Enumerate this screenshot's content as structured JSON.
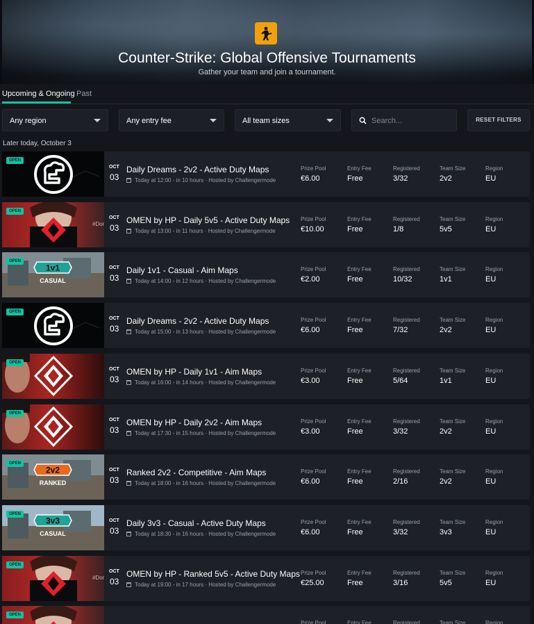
{
  "hero": {
    "title": "Counter-Strike: Global Offensive Tournaments",
    "subtitle": "Gather your team and join a tournament.",
    "game_icon": "csgo-soldier-icon",
    "accent": "#f0a10a"
  },
  "tabs": {
    "active": "Upcoming & Ongoing",
    "inactive": "Past"
  },
  "filters": {
    "region": "Any region",
    "entry_fee": "Any entry fee",
    "team_size": "All team sizes",
    "search_placeholder": "Search...",
    "reset_label": "RESET FILTERS"
  },
  "date_heading": "Later today, October 3",
  "colors": {
    "accent": "#12c2a0",
    "row_bg": "#1d2027",
    "page_bg": "#14161c"
  },
  "labels": {
    "prize": "Prize Pool",
    "fee": "Entry Fee",
    "registered": "Registered",
    "team_size": "Team Size",
    "region": "Region",
    "badge": "OPEN"
  },
  "tournaments": [
    {
      "thumb": "daily-dreams-logo",
      "month": "OCT",
      "day": "03",
      "title": "Daily Dreams - 2v2 - Active Duty Maps",
      "time": "Today at 12:00 - in 10 hours",
      "host": "Hosted by Challengermode",
      "prize": "€6.00",
      "fee": "Free",
      "registered": "3/32",
      "team_size": "2v2",
      "region": "EU"
    },
    {
      "thumb": "omen-5v5",
      "month": "OCT",
      "day": "03",
      "title": "OMEN by HP - Daily 5v5 - Active Duty Maps",
      "time": "Today at 13:00 - in 11 hours",
      "host": "Hosted by Challengermode",
      "prize": "€10.00",
      "fee": "Free",
      "registered": "1/8",
      "team_size": "5v5",
      "region": "EU"
    },
    {
      "thumb": "casual-1v1",
      "badge_text": "1v1",
      "badge_sub": "CASUAL",
      "month": "OCT",
      "day": "03",
      "title": "Daily 1v1 - Casual - Aim Maps",
      "time": "Today at 14:00 - in 12 hours",
      "host": "Hosted by Challengermode",
      "prize": "€2.00",
      "fee": "Free",
      "registered": "10/32",
      "team_size": "1v1",
      "region": "EU"
    },
    {
      "thumb": "daily-dreams-logo",
      "month": "OCT",
      "day": "03",
      "title": "Daily Dreams - 2v2 - Active Duty Maps",
      "time": "Today at 15:00 - in 13 hours",
      "host": "Hosted by Challengermode",
      "prize": "€6.00",
      "fee": "Free",
      "registered": "7/32",
      "team_size": "2v2",
      "region": "EU"
    },
    {
      "thumb": "omen-aim",
      "month": "OCT",
      "day": "03",
      "title": "OMEN by HP - Daily 1v1 - Aim Maps",
      "time": "Today at 16:00 - in 14 hours",
      "host": "Hosted by Challengermode",
      "prize": "€3.00",
      "fee": "Free",
      "registered": "5/64",
      "team_size": "1v1",
      "region": "EU"
    },
    {
      "thumb": "omen-aim",
      "month": "OCT",
      "day": "03",
      "title": "OMEN by HP - Daily 2v2 - Aim Maps",
      "time": "Today at 17:30 - in 15 hours",
      "host": "Hosted by Challengermode",
      "prize": "€3.00",
      "fee": "Free",
      "registered": "3/32",
      "team_size": "2v2",
      "region": "EU"
    },
    {
      "thumb": "ranked-2v2",
      "badge_text": "2v2",
      "badge_sub": "RANKED",
      "month": "OCT",
      "day": "03",
      "title": "Ranked 2v2 - Competitive - Aim Maps",
      "time": "Today at 18:00 - in 16 hours",
      "host": "Hosted by Challengermode",
      "prize": "€6.00",
      "fee": "Free",
      "registered": "2/16",
      "team_size": "2v2",
      "region": "EU"
    },
    {
      "thumb": "casual-3v3",
      "badge_text": "3v3",
      "badge_sub": "CASUAL",
      "month": "OCT",
      "day": "03",
      "title": "Daily 3v3 - Casual - Active Duty Maps",
      "time": "Today at 18:30 - in 16 hours",
      "host": "Hosted by Challengermode",
      "prize": "€6.00",
      "fee": "Free",
      "registered": "3/32",
      "team_size": "3v3",
      "region": "EU"
    },
    {
      "thumb": "omen-5v5",
      "month": "OCT",
      "day": "03",
      "title": "OMEN by HP - Ranked 5v5 - Active Duty Maps",
      "time": "Today at 19:00 - in 17 hours",
      "host": "Hosted by Challengermode",
      "prize": "€25.00",
      "fee": "Free",
      "registered": "3/16",
      "team_size": "5v5",
      "region": "EU"
    },
    {
      "thumb": "omen-5v5",
      "month": "",
      "day": "",
      "title": "",
      "time": "",
      "host": "",
      "prize": "",
      "fee": "",
      "registered": "",
      "team_size": "",
      "region": ""
    }
  ]
}
